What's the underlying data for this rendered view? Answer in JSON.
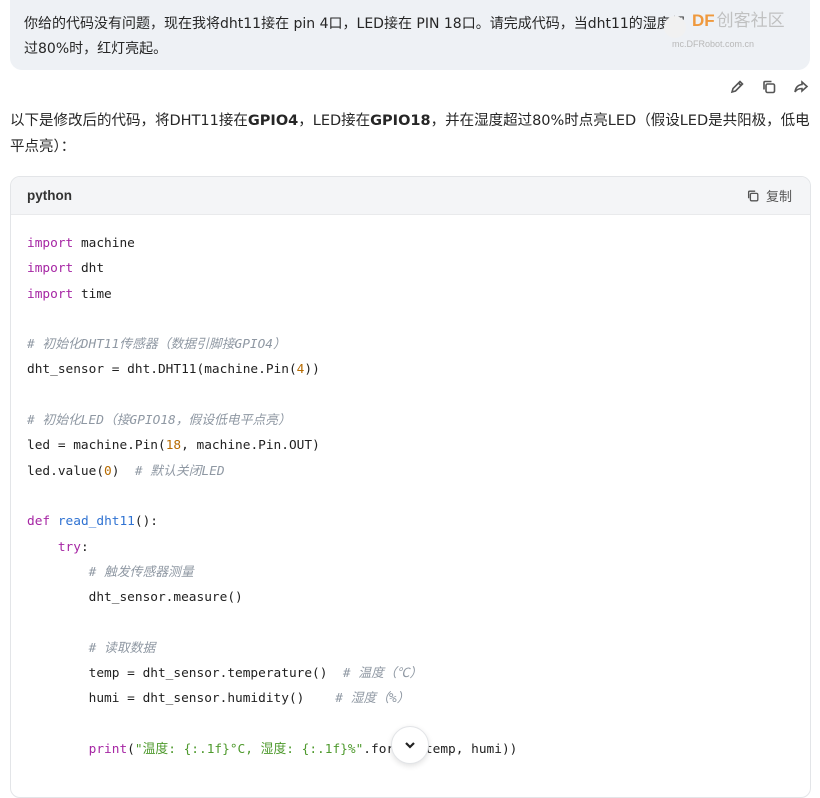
{
  "user_message": {
    "text": "你给的代码没有问题，现在我将dht11接在 pin 4口，LED接在 PIN 18口。请完成代码，当dht11的湿度超过80%时，红灯亮起。"
  },
  "watermark": {
    "brand": "DF",
    "brand_suffix": "创客社区",
    "url": "mc.DFRobot.com.cn"
  },
  "message_actions": {
    "edit_icon": "pencil-icon",
    "copy_icon": "copy-icon",
    "share_icon": "share-icon"
  },
  "answer": {
    "intro": "以下是修改后的代码，将DHT11接在GPIO4，LED接在GPIO18，并在湿度超过80%时点亮LED（假设LED是共阳极，低电平点亮）："
  },
  "code_block": {
    "language": "python",
    "copy_label": "复制",
    "lines": [
      "import machine",
      "import dht",
      "import time",
      "",
      "# 初始化DHT11传感器（数据引脚接GPIO4）",
      "dht_sensor = dht.DHT11(machine.Pin(4))",
      "",
      "# 初始化LED（接GPIO18，假设低电平点亮）",
      "led = machine.Pin(18, machine.Pin.OUT)",
      "led.value(0)  # 默认关闭LED",
      "",
      "def read_dht11():",
      "    try:",
      "        # 触发传感器测量",
      "        dht_sensor.measure()",
      "",
      "        # 读取数据",
      "        temp = dht_sensor.temperature()  # 温度（℃）",
      "        humi = dht_sensor.humidity()    # 湿度（%）",
      "",
      "        print(\"温度: {:.1f}°C, 湿度: {:.1f}%\".format(temp, humi))"
    ]
  },
  "scroll_button": {
    "icon": "chevron-down-icon"
  }
}
